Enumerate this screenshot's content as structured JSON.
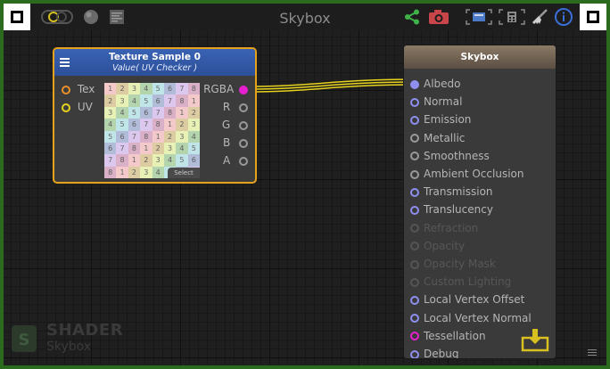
{
  "window": {
    "title": "Skybox"
  },
  "texture_node": {
    "title": "Texture Sample 0",
    "subtitle": "Value( UV Checker )",
    "inputs": [
      {
        "label": "Tex",
        "color": "#e8902a"
      },
      {
        "label": "UV",
        "color": "#e6d21e"
      }
    ],
    "outputs": [
      {
        "label": "RGBA",
        "color": "#e81fd0"
      },
      {
        "label": "R",
        "color": "#9a9a9a"
      },
      {
        "label": "G",
        "color": "#9a9a9a"
      },
      {
        "label": "B",
        "color": "#9a9a9a"
      },
      {
        "label": "A",
        "color": "#9a9a9a"
      }
    ],
    "select_label": "Select",
    "uv_checker_numbers": [
      [
        "1",
        "2",
        "3",
        "4",
        "5",
        "6",
        "7",
        "8"
      ],
      [
        "2",
        "3",
        "4",
        "5",
        "6",
        "7",
        "8",
        "1"
      ],
      [
        "3",
        "4",
        "5",
        "6",
        "7",
        "8",
        "1",
        "2"
      ],
      [
        "4",
        "5",
        "6",
        "7",
        "8",
        "1",
        "2",
        "3"
      ],
      [
        "5",
        "6",
        "7",
        "8",
        "1",
        "2",
        "3",
        "4"
      ],
      [
        "6",
        "7",
        "8",
        "1",
        "2",
        "3",
        "4",
        "5"
      ],
      [
        "7",
        "8",
        "1",
        "2",
        "3",
        "4",
        "5",
        "6"
      ],
      [
        "8",
        "1",
        "2",
        "3",
        "4",
        "5",
        "6",
        "7"
      ]
    ]
  },
  "skybox_node": {
    "title": "Skybox",
    "ports": [
      {
        "label": "Albedo",
        "state": "connected",
        "color": "#8f8ff0"
      },
      {
        "label": "Normal",
        "state": "active",
        "color": "#8f8ff0"
      },
      {
        "label": "Emission",
        "state": "active",
        "color": "#8f8ff0"
      },
      {
        "label": "Metallic",
        "state": "active",
        "color": "#9a9a9a"
      },
      {
        "label": "Smoothness",
        "state": "active",
        "color": "#9a9a9a"
      },
      {
        "label": "Ambient Occlusion",
        "state": "active",
        "color": "#9a9a9a"
      },
      {
        "label": "Transmission",
        "state": "active",
        "color": "#8f8ff0"
      },
      {
        "label": "Translucency",
        "state": "active",
        "color": "#8f8ff0"
      },
      {
        "label": "Refraction",
        "state": "disabled",
        "color": "#555555"
      },
      {
        "label": "Opacity",
        "state": "disabled",
        "color": "#555555"
      },
      {
        "label": "Opacity Mask",
        "state": "disabled",
        "color": "#555555"
      },
      {
        "label": "Custom Lighting",
        "state": "disabled",
        "color": "#555555"
      },
      {
        "label": "Local Vertex Offset",
        "state": "active",
        "color": "#8f8ff0"
      },
      {
        "label": "Local Vertex Normal",
        "state": "active",
        "color": "#8f8ff0"
      },
      {
        "label": "Tessellation",
        "state": "active",
        "color": "#e81fd0"
      },
      {
        "label": "Debug",
        "state": "active",
        "color": "#8f8ff0"
      }
    ]
  },
  "watermark": {
    "title": "SHADER",
    "subtitle": "Skybox"
  },
  "toolbar": {
    "left_icons": [
      "live-mode-icon",
      "preview-sphere-icon",
      "shader-code-icon"
    ],
    "right_icons": [
      "share-icon",
      "screenshot-camera-icon",
      "take-snapshot-icon",
      "calculator-icon",
      "cleanup-broom-icon",
      "info-icon"
    ]
  },
  "colors": {
    "accent": "#e6a21b",
    "wire": "#e6d21e"
  }
}
